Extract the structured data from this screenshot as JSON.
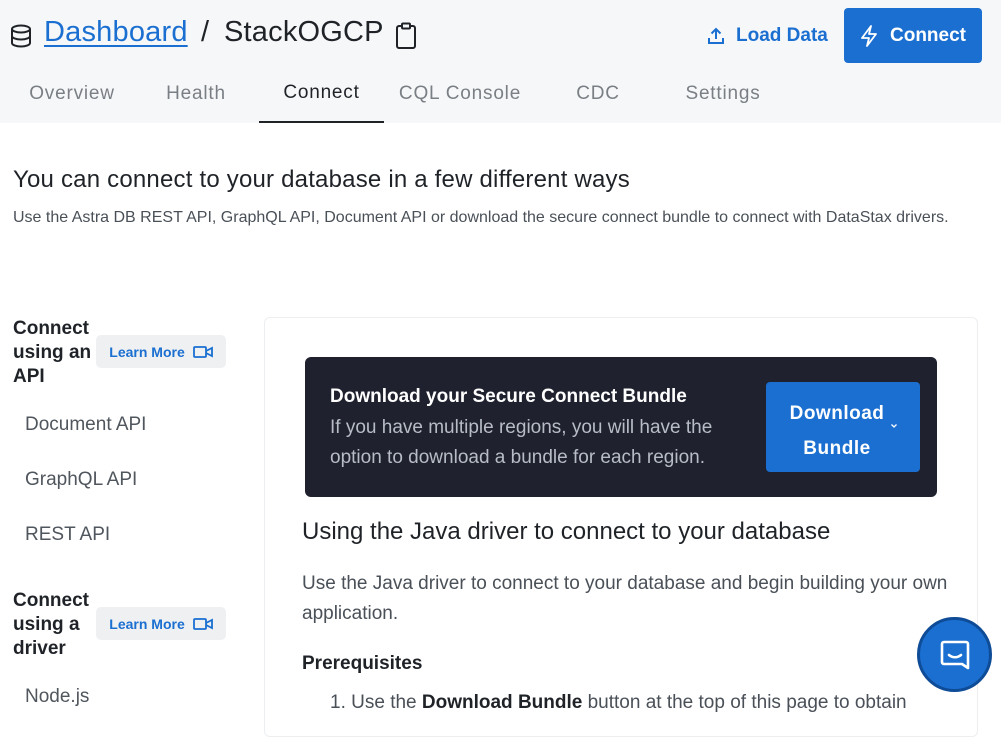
{
  "breadcrumb": {
    "root": "Dashboard",
    "separator": "/",
    "current": "StackOGCP"
  },
  "header": {
    "load_label": "Load Data",
    "connect_label": "Connect"
  },
  "tabs": [
    {
      "label": "Overview",
      "active": false
    },
    {
      "label": "Health",
      "active": false
    },
    {
      "label": "Connect",
      "active": true
    },
    {
      "label": "CQL Console",
      "active": false
    },
    {
      "label": "CDC",
      "active": false
    },
    {
      "label": "Settings",
      "active": false
    }
  ],
  "intro": {
    "title": "You can connect to your database in a few different ways",
    "description": "Use the Astra DB REST API, GraphQL API, Document API or download the secure connect bundle to connect with DataStax drivers."
  },
  "sidebar": {
    "api_section": {
      "title": "Connect using an API",
      "learn_more": "Learn More",
      "items": [
        "Document API",
        "GraphQL API",
        "REST API"
      ]
    },
    "driver_section": {
      "title": "Connect using a driver",
      "learn_more": "Learn More",
      "items": [
        "Node.js"
      ]
    }
  },
  "banner": {
    "title": "Download your Secure Connect Bundle",
    "description": "If you have multiple regions, you will have the option to download a bundle for each region.",
    "button_label": "Download Bundle"
  },
  "content": {
    "java_title": "Using the Java driver to connect to your database",
    "java_description": "Use the Java driver to connect to your database and begin building your own application.",
    "prerequisites_heading": "Prerequisites",
    "step1_prefix": "1. Use the ",
    "step1_bold": "Download Bundle",
    "step1_suffix": " button at the top of this page to obtain"
  },
  "colors": {
    "accent": "#1a6fd1",
    "banner_bg": "#1f222e",
    "header_bg": "#f6f7f8"
  },
  "icons": {
    "database": "database-icon",
    "clipboard": "clipboard-icon",
    "upload": "upload-icon",
    "bolt": "lightning-bolt-icon",
    "video": "video-camera-icon",
    "chevron": "chevron-down-icon",
    "chat": "chat-icon"
  }
}
